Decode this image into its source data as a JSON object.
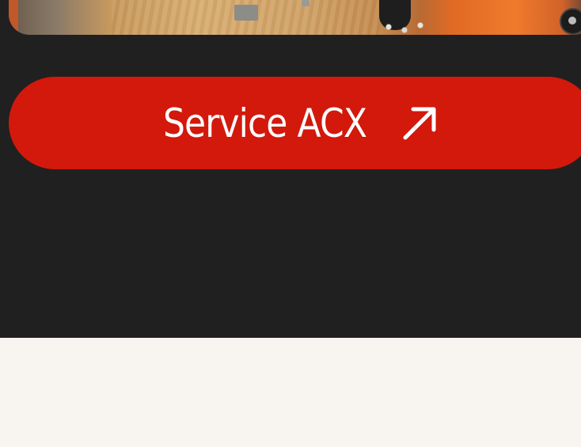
{
  "hero_image": {
    "description_icon": "workshop-photo",
    "accent": "#e06a24"
  },
  "cta": {
    "label": "Service ACX",
    "icon": "arrow-up-right-icon",
    "background": "#d2190b",
    "text_color": "#ffffff"
  },
  "colors": {
    "dark_section": "#202020",
    "light_section": "#f8f4f0"
  }
}
